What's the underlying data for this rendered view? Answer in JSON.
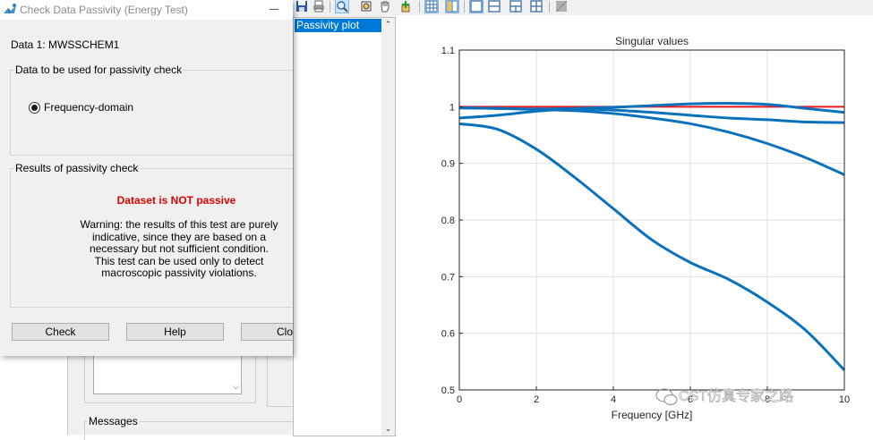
{
  "dialog": {
    "title": "Check Data Passivity (Energy Test)",
    "data_label": "Data 1: MWSSCHEM1",
    "group_data": {
      "title": "Data to be used for passivity check",
      "option": "Frequency-domain"
    },
    "group_results": {
      "title": "Results of passivity check",
      "status": "Dataset is NOT passive",
      "warning": [
        "Warning: the results of this test are purely",
        "indicative, since they are based on a",
        "necessary but not sufficient condition.",
        "This test can be used only to detect",
        "macroscopic passivity violations."
      ]
    },
    "buttons": {
      "check": "Check",
      "help": "Help",
      "close": "Clo"
    },
    "colors": {
      "status": "#e00000"
    }
  },
  "background_window": {
    "messages_label": "Messages"
  },
  "figure": {
    "list": {
      "items": [
        "Passivity plot"
      ]
    },
    "toolbar": {
      "icons": [
        "save-icon",
        "print-icon",
        "zoom-in-icon",
        "zoom-out-icon",
        "pan-icon",
        "data-cursor-icon",
        "grid-1-icon",
        "grid-2-icon",
        "layout-single-icon",
        "layout-rows-icon",
        "layout-cols-icon",
        "layout-grid-icon",
        "disabled-icon"
      ]
    },
    "watermark": "CST仿真专家之路"
  },
  "chart_data": {
    "type": "line",
    "title": "Singular values",
    "xlabel": "Frequency [GHz]",
    "ylabel": "",
    "xlim": [
      0,
      10
    ],
    "ylim": [
      0.5,
      1.1
    ],
    "xticks": [
      0,
      2,
      4,
      6,
      8,
      10
    ],
    "yticks": [
      0.5,
      0.6,
      0.7,
      0.8,
      0.9,
      1,
      1.1
    ],
    "grid": true,
    "reference_line": {
      "y": 1.0,
      "color": "#e8191c"
    },
    "series_color": "#0a72bd",
    "series": [
      {
        "x": [
          0,
          1,
          2,
          3,
          4,
          5,
          6,
          7,
          8,
          9,
          10
        ],
        "y": [
          0.97,
          0.96,
          0.925,
          0.875,
          0.82,
          0.765,
          0.725,
          0.695,
          0.655,
          0.605,
          0.535
        ]
      },
      {
        "x": [
          0,
          1,
          2,
          3,
          4,
          5,
          6,
          7,
          8,
          9,
          10
        ],
        "y": [
          0.998,
          0.997,
          0.995,
          0.993,
          0.988,
          0.98,
          0.97,
          0.955,
          0.935,
          0.91,
          0.88
        ]
      },
      {
        "x": [
          0,
          1,
          2,
          3,
          4,
          5,
          6,
          7,
          8,
          9,
          10
        ],
        "y": [
          0.98,
          0.985,
          0.992,
          0.996,
          0.994,
          0.99,
          0.985,
          0.98,
          0.977,
          0.973,
          0.972
        ]
      },
      {
        "x": [
          0,
          1,
          2,
          3,
          4,
          5,
          6,
          7,
          8,
          9,
          10
        ],
        "y": [
          0.998,
          0.997,
          0.996,
          0.997,
          0.999,
          1.002,
          1.005,
          1.006,
          1.004,
          0.997,
          0.99
        ]
      }
    ]
  }
}
